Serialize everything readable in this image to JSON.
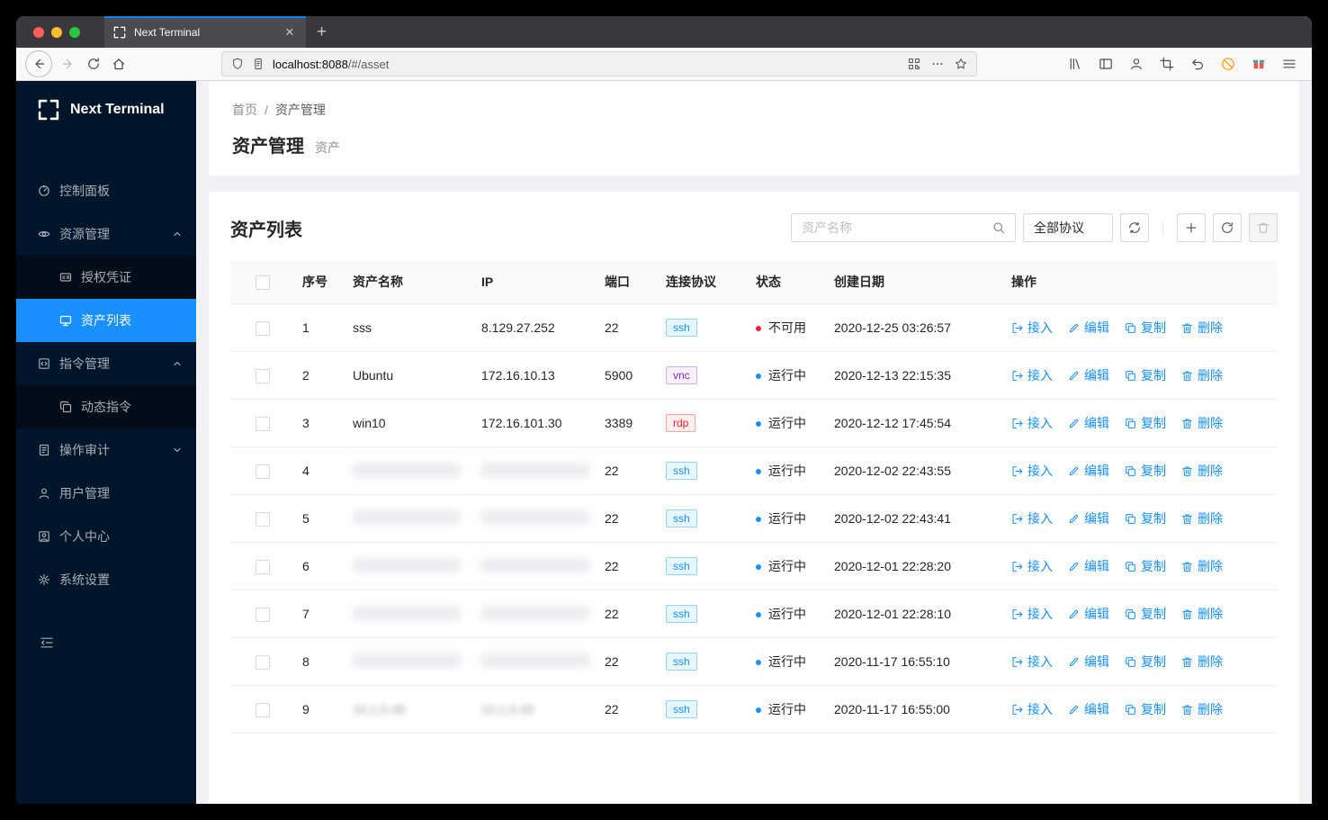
{
  "colors": {
    "accent": "#1890ff",
    "sidebar_bg": "#001529",
    "status_running": "#1890ff",
    "status_unavailable": "#f5222d",
    "tag_ssh": "#1890ff",
    "tag_vnc": "#722ed1",
    "tag_rdp": "#f5222d"
  },
  "browser": {
    "tab_title": "Next Terminal",
    "url_host": "localhost:8088",
    "url_path": "/#/asset"
  },
  "sidebar": {
    "logo_text": "Next Terminal",
    "items": [
      {
        "label": "控制面板"
      },
      {
        "label": "资源管理",
        "expanded": true
      },
      {
        "label": "授权凭证",
        "submenu": true
      },
      {
        "label": "资产列表",
        "submenu": true,
        "active": true
      },
      {
        "label": "指令管理",
        "expanded": true
      },
      {
        "label": "动态指令",
        "submenu": true
      },
      {
        "label": "操作审计",
        "collapsed": true
      },
      {
        "label": "用户管理"
      },
      {
        "label": "个人中心"
      },
      {
        "label": "系统设置"
      }
    ]
  },
  "breadcrumb": {
    "home": "首页",
    "separator": "/",
    "current": "资产管理"
  },
  "page": {
    "title": "资产管理",
    "subtitle": "资产"
  },
  "card": {
    "title": "资产列表",
    "search_placeholder": "资产名称",
    "protocol_filter": "全部协议"
  },
  "table": {
    "headers": [
      "序号",
      "资产名称",
      "IP",
      "端口",
      "连接协议",
      "状态",
      "创建日期",
      "操作"
    ],
    "action_labels": [
      "接入",
      "编辑",
      "复制",
      "删除"
    ],
    "rows": [
      {
        "no": "1",
        "name": "sss",
        "ip": "8.129.27.252",
        "port": "22",
        "protocol": "ssh",
        "status": "不可用",
        "status_color": "red",
        "created": "2020-12-25 03:26:57",
        "masked": false
      },
      {
        "no": "2",
        "name": "Ubuntu",
        "ip": "172.16.10.13",
        "port": "5900",
        "protocol": "vnc",
        "status": "运行中",
        "status_color": "blue",
        "created": "2020-12-13 22:15:35",
        "masked": false
      },
      {
        "no": "3",
        "name": "win10",
        "ip": "172.16.101.30",
        "port": "3389",
        "protocol": "rdp",
        "status": "运行中",
        "status_color": "blue",
        "created": "2020-12-12 17:45:54",
        "masked": false
      },
      {
        "no": "4",
        "name": "",
        "ip": "",
        "port": "22",
        "protocol": "ssh",
        "status": "运行中",
        "status_color": "blue",
        "created": "2020-12-02 22:43:55",
        "masked": true
      },
      {
        "no": "5",
        "name": "",
        "ip": "",
        "port": "22",
        "protocol": "ssh",
        "status": "运行中",
        "status_color": "blue",
        "created": "2020-12-02 22:43:41",
        "masked": true
      },
      {
        "no": "6",
        "name": "",
        "ip": "",
        "port": "22",
        "protocol": "ssh",
        "status": "运行中",
        "status_color": "blue",
        "created": "2020-12-01 22:28:20",
        "masked": true
      },
      {
        "no": "7",
        "name": "",
        "ip": "",
        "port": "22",
        "protocol": "ssh",
        "status": "运行中",
        "status_color": "blue",
        "created": "2020-12-01 22:28:10",
        "masked": true
      },
      {
        "no": "8",
        "name": "",
        "ip": "",
        "port": "22",
        "protocol": "ssh",
        "status": "运行中",
        "status_color": "blue",
        "created": "2020-11-17 16:55:10",
        "masked": true
      },
      {
        "no": "9",
        "name": "10.1.5.49",
        "ip": "10.1.5.49",
        "port": "22",
        "protocol": "ssh",
        "status": "运行中",
        "status_color": "blue",
        "created": "2020-11-17 16:55:00",
        "masked": true
      }
    ]
  }
}
